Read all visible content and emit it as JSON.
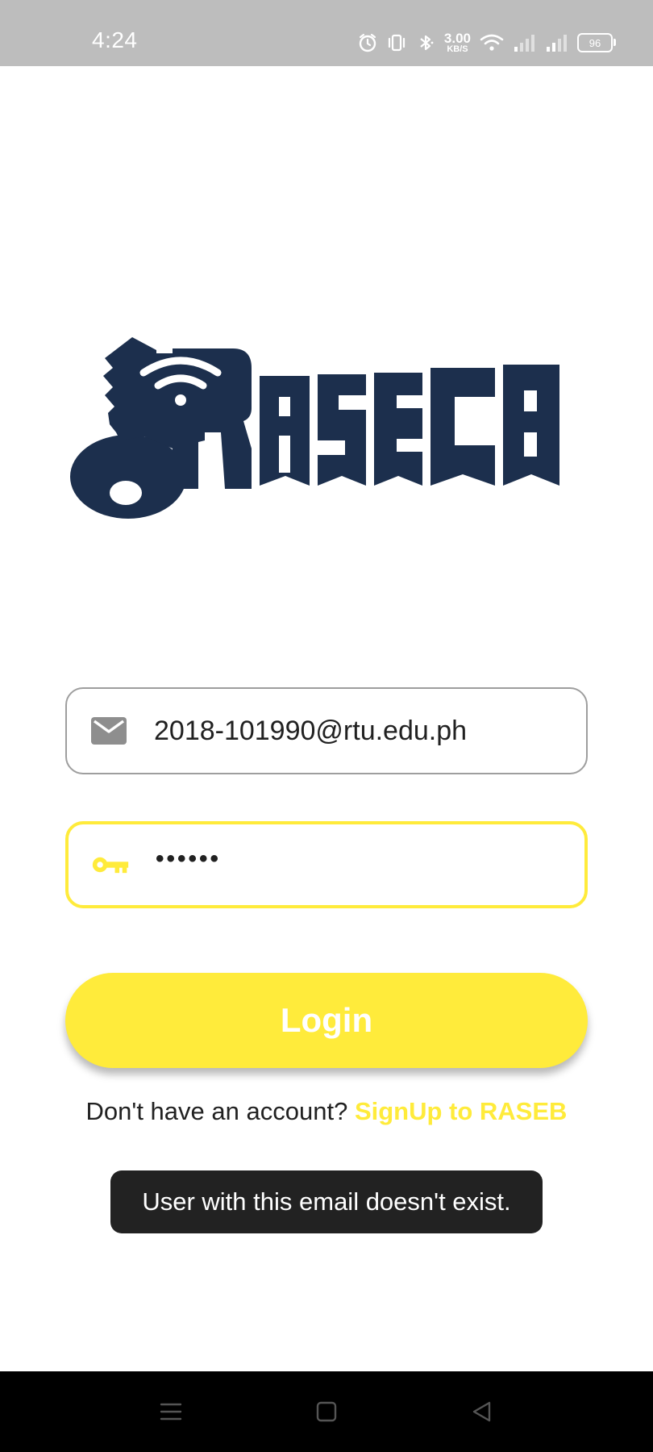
{
  "status_bar": {
    "time": "4:24",
    "net_speed_value": "3.00",
    "net_speed_unit": "KB/S",
    "battery_level": "96",
    "icons": [
      "alarm-icon",
      "vibrate-icon",
      "bluetooth-icon",
      "wifi-icon",
      "signal-icon",
      "signal-icon"
    ]
  },
  "logo": {
    "text": "RASEB",
    "color": "#1c2f4d"
  },
  "form": {
    "email_value": "2018-101990@rtu.edu.ph",
    "email_icon": "email-icon",
    "password_masked": "••••••",
    "password_icon": "key-icon",
    "login_label": "Login",
    "signup_prompt": "Don't have an account?",
    "signup_link": "SignUp to RASEB"
  },
  "toast": {
    "message": "User with this email doesn't exist."
  },
  "nav_bar": {
    "buttons": [
      "menu-icon",
      "home-icon",
      "back-icon"
    ]
  },
  "colors": {
    "accent": "#ffeb3b",
    "brand": "#1c2f4d",
    "status_bar": "#bdbdbd",
    "toast_bg": "#222222"
  }
}
